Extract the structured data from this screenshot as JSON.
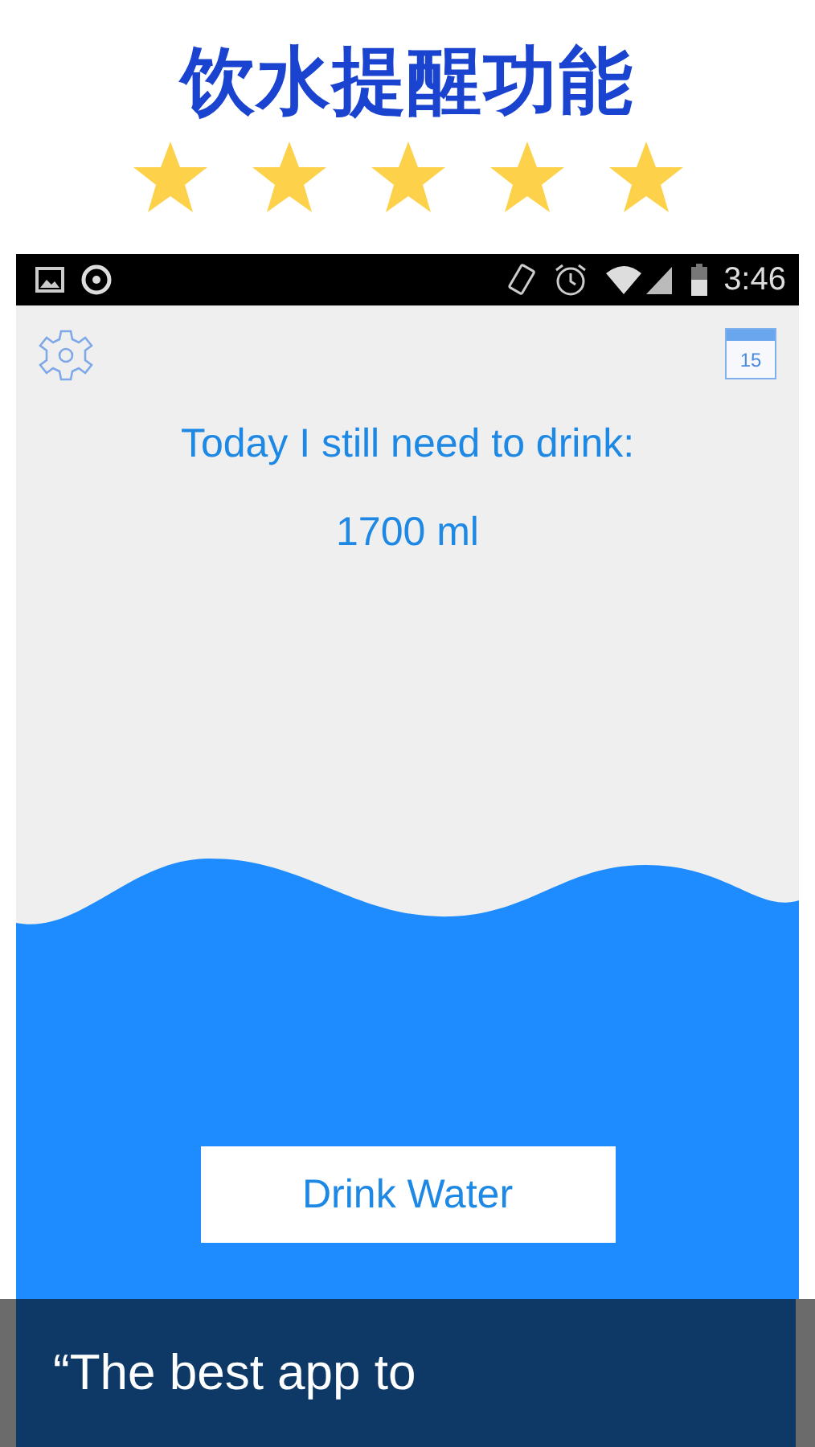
{
  "header": {
    "title": "饮水提醒功能",
    "stars": 5
  },
  "status_bar": {
    "time": "3:46"
  },
  "toolbar": {
    "calendar_day": "15"
  },
  "message": "Today I still need to drink:",
  "amount": "1700 ml",
  "button": "Drink Water",
  "banner": "“The best app to"
}
